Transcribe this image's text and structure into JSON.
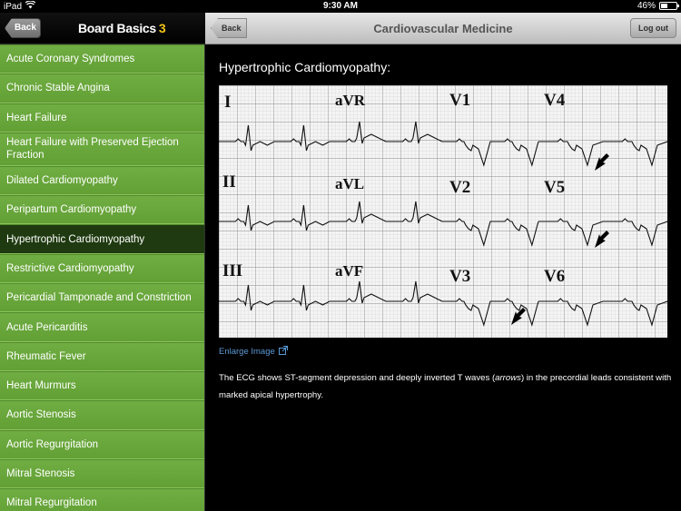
{
  "status_bar": {
    "device": "iPad",
    "time": "9:30 AM",
    "battery": "46%",
    "battery_level": 0.46
  },
  "left_nav": {
    "back_label": "Back",
    "brand": "Board Basics",
    "brand_number": "3"
  },
  "right_nav": {
    "back_label": "Back",
    "title": "Cardiovascular Medicine",
    "logout_label": "Log out"
  },
  "sidebar": {
    "items": [
      {
        "label": "Acute Coronary Syndromes"
      },
      {
        "label": "Chronic Stable Angina"
      },
      {
        "label": "Heart Failure"
      },
      {
        "label": "Heart Failure with Preserved Ejection Fraction"
      },
      {
        "label": "Dilated Cardiomyopathy"
      },
      {
        "label": "Peripartum Cardiomyopathy"
      },
      {
        "label": "Hypertrophic Cardiomyopathy",
        "selected": true
      },
      {
        "label": "Restrictive Cardiomyopathy"
      },
      {
        "label": "Pericardial Tamponade and Constriction"
      },
      {
        "label": "Acute Pericarditis"
      },
      {
        "label": "Rheumatic Fever"
      },
      {
        "label": "Heart Murmurs"
      },
      {
        "label": "Aortic Stenosis"
      },
      {
        "label": "Aortic Regurgitation"
      },
      {
        "label": "Mitral Stenosis"
      },
      {
        "label": "Mitral Regurgitation"
      }
    ]
  },
  "content": {
    "heading": "Hypertrophic Cardiomyopathy:",
    "ecg_leads": {
      "row1": [
        "I",
        "aVR",
        "V1",
        "V4"
      ],
      "row2": [
        "II",
        "aVL",
        "V2",
        "V5"
      ],
      "row3": [
        "III",
        "aVF",
        "V3",
        "V6"
      ]
    },
    "enlarge_label": "Enlarge Image",
    "caption_part1": "The ECG shows ST-segment depression and deeply inverted T waves (",
    "caption_em": "arrows",
    "caption_part2": ") in the precordial leads consistent with marked apical hypertrophy."
  }
}
